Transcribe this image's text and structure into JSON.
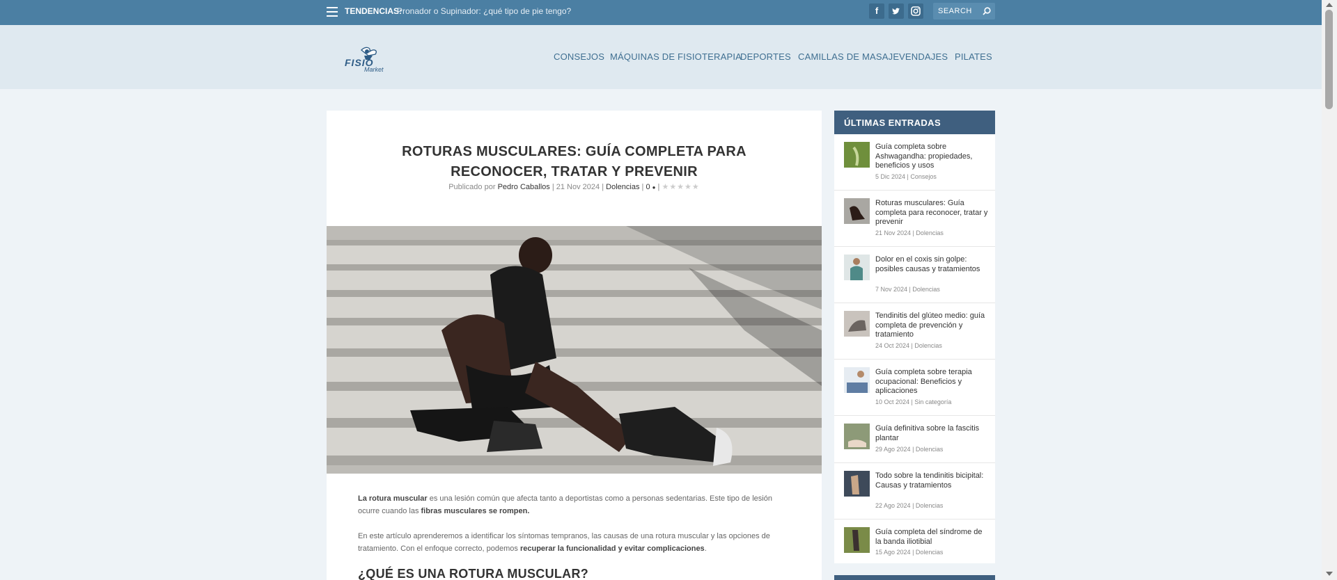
{
  "topbar": {
    "trending_label": "TENDENCIAS:",
    "trending_link": "Pronador o Supinador: ¿qué tipo de pie tengo?",
    "social": [
      {
        "name": "facebook-icon",
        "glyph": "f"
      },
      {
        "name": "twitter-icon",
        "glyph": "t"
      },
      {
        "name": "instagram-icon",
        "glyph": "◙"
      }
    ],
    "search_placeholder": "SEARCH"
  },
  "header": {
    "logo_text": "FISIO",
    "logo_subtext": "Market",
    "nav": [
      "CONSEJOS",
      "MÁQUINAS DE FISIOTERAPIA",
      "DEPORTES",
      "CAMILLAS DE MASAJE",
      "VENDAJES",
      "PILATES"
    ]
  },
  "article": {
    "title": "ROTURAS MUSCULARES: GUÍA COMPLETA PARA RECONOCER, TRATAR Y PREVENIR",
    "meta": {
      "prefix": "Publicado por",
      "author": "Pedro Caballos",
      "date": "21 Nov 2024",
      "category": "Dolencias",
      "comments": "0",
      "stars": "★★★★★"
    },
    "p1": {
      "b1": "La rotura muscular",
      "t1": " es una lesión común que afecta tanto a deportistas como a personas sedentarias. Este tipo de lesión ocurre cuando las ",
      "b2": "fibras musculares se rompen.",
      "t2": ""
    },
    "p2": {
      "t1": "En este artículo aprenderemos a identificar los síntomas tempranos, las causas de una rotura muscular y las opciones de tratamiento. Con el enfoque correcto, podemos ",
      "b1": "recuperar la funcionalidad y evitar complicaciones",
      "t2": "."
    },
    "h2": "¿QUÉ ES UNA ROTURA MUSCULAR?"
  },
  "sidebar": {
    "heading": "ÚLTIMAS ENTRADAS",
    "posts": [
      {
        "title": "Guía completa sobre Ashwagandha: propiedades, beneficios y usos",
        "date": "5 Dic 2024",
        "category": "Consejos",
        "color": "#6f8f3c"
      },
      {
        "title": "Roturas musculares: Guía completa para reconocer, tratar y prevenir",
        "date": "21 Nov 2024",
        "category": "Dolencias",
        "color": "#7d756b"
      },
      {
        "title": "Dolor en el coxis sin golpe: posibles causas y tratamientos",
        "date": "7 Nov 2024",
        "category": "Dolencias",
        "color": "#4f8a88"
      },
      {
        "title": "Tendinitis del glúteo medio: guía completa de prevención y tratamiento",
        "date": "24 Oct 2024",
        "category": "Dolencias",
        "color": "#6b6460"
      },
      {
        "title": "Guía completa sobre terapia ocupacional: Beneficios y aplicaciones",
        "date": "10 Oct 2024",
        "category": "Sin categoría",
        "color": "#5f7da3"
      },
      {
        "title": "Guía definitiva sobre la fascitis plantar",
        "date": "29 Ago 2024",
        "category": "Dolencias",
        "color": "#8d9a78"
      },
      {
        "title": "Todo sobre la tendinitis bicipital: Causas y tratamientos",
        "date": "22 Ago 2024",
        "category": "Dolencias",
        "color": "#3e4a5a"
      },
      {
        "title": "Guía completa del síndrome de la banda iliotibial",
        "date": "15 Ago 2024",
        "category": "Dolencias",
        "color": "#7a8b48"
      }
    ]
  }
}
